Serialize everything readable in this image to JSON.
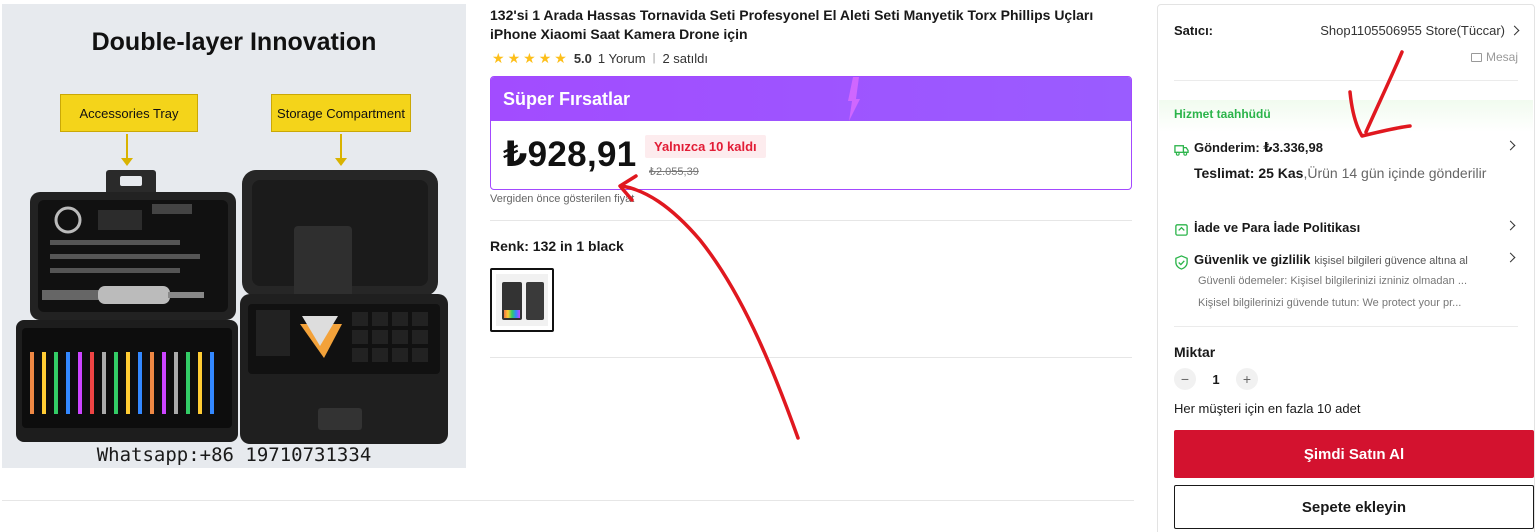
{
  "image": {
    "headline": "Double-layer Innovation",
    "tag_left": "Accessories Tray",
    "tag_right": "Storage Compartment",
    "watermark": "Whatsapp:+86 19710731334"
  },
  "product": {
    "title": "132'si 1 Arada Hassas Tornavida Seti Profesyonel El Aleti Seti Manyetik Torx Phillips Uçları iPhone Xiaomi Saat Kamera Drone için",
    "rating": "5.0",
    "reviews": "1 Yorum",
    "sold": "2 satıldı"
  },
  "deal": {
    "banner": "Süper Fırsatlar",
    "price": "₺928,91",
    "stock_badge": "Yalnızca 10 kaldı",
    "old_price": "₺2.055,39",
    "tax_note": "Vergiden önce gösterilen fiyat"
  },
  "variant": {
    "label": "Renk: 132 in 1 black"
  },
  "seller": {
    "label": "Satıcı:",
    "name": "Shop1105506955 Store(Tüccar)",
    "message": "Mesaj"
  },
  "service": {
    "title": "Hizmet taahhüdü",
    "shipping": "Gönderim: ₺3.336,98",
    "delivery_label": "Teslimat: 25 Kas",
    "delivery_note": ",Ürün 14 gün içinde gönderilir",
    "returns": "İade ve Para İade Politikası",
    "security_title": "Güvenlik ve gizlilik",
    "security_sub": "kişisel bilgileri güvence altına al",
    "security_line1": "Güvenli ödemeler: Kişisel bilgilerinizi izniniz olmadan ...",
    "security_line2": "Kişisel bilgilerinizi güvende tutun: We protect your pr..."
  },
  "quantity": {
    "label": "Miktar",
    "value": "1",
    "minus": "−",
    "plus": "+",
    "limit": "Her müşteri için en fazla 10 adet"
  },
  "actions": {
    "buy_now": "Şimdi Satın Al",
    "add_to_cart": "Sepete ekleyin"
  },
  "colors": {
    "deal_purple": "#a24cff",
    "buy_red": "#d3122f",
    "star_yellow": "#fdbf1a",
    "service_green": "#2bb44a",
    "annotation_red": "#e0181f"
  },
  "icons": [
    "star-icon",
    "message-icon",
    "truck-icon",
    "return-icon",
    "shield-icon",
    "chevron-right-icon"
  ]
}
